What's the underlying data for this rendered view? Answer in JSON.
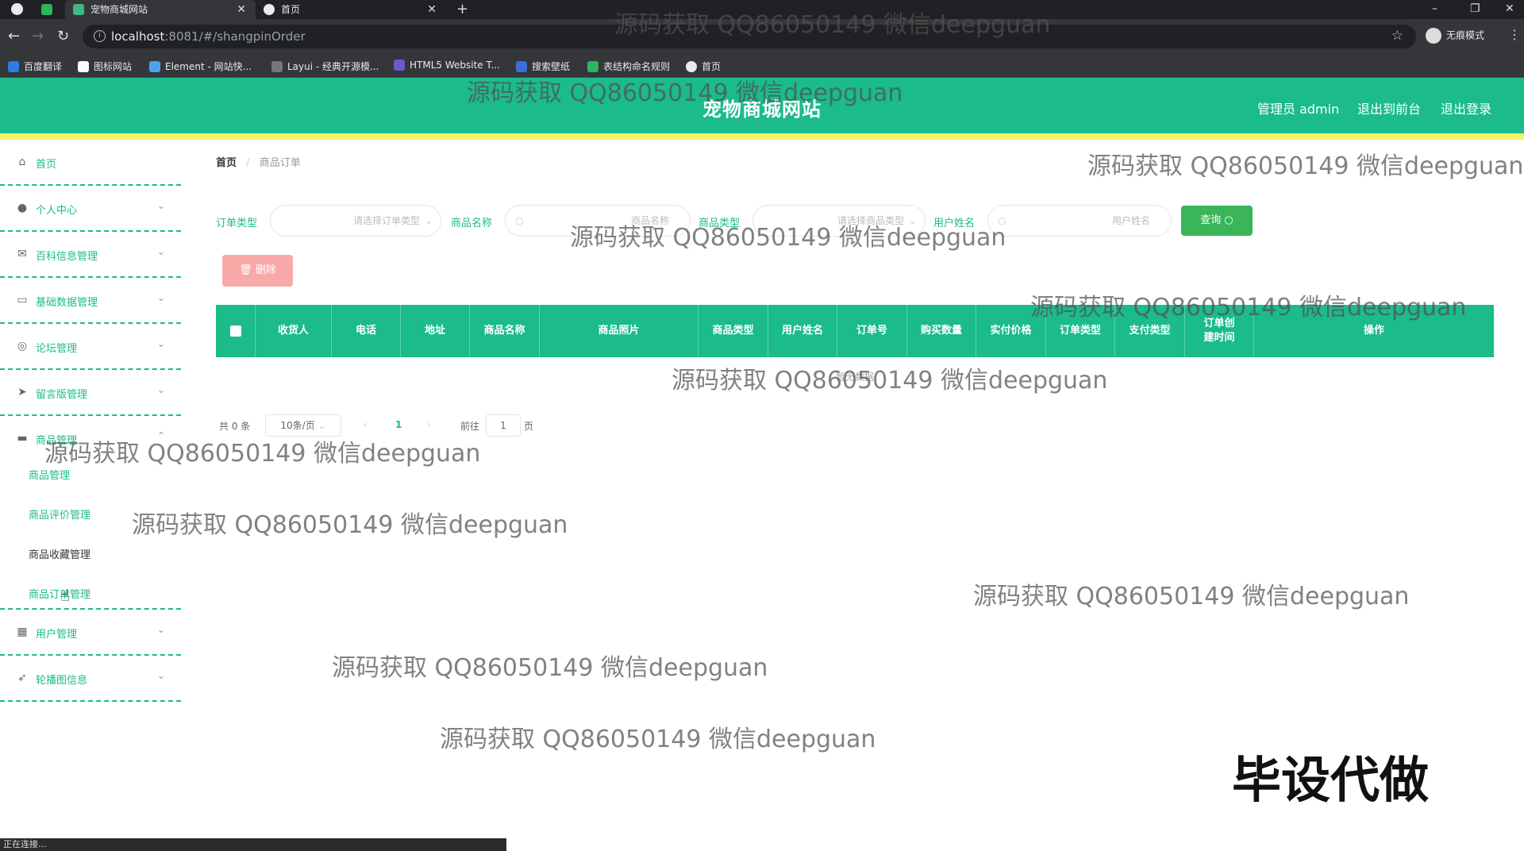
{
  "browser": {
    "tabs": [
      {
        "title": "宠物商城网站",
        "active": true
      },
      {
        "title": "首页",
        "active": false
      }
    ],
    "url_host": "localhost",
    "url_rest": ":8081/#/shangpinOrder",
    "incognito_label": "无痕模式",
    "bookmarks": [
      "百度翻译",
      "图标网站",
      "Element - 网站快...",
      "Layui - 经典开源模...",
      "HTML5 Website T...",
      "搜索壁纸",
      "表结构命名规则",
      "首页"
    ],
    "status": "正在连接..."
  },
  "header": {
    "site_title": "宠物商城网站",
    "admin": "管理员 admin",
    "to_front": "退出到前台",
    "logout": "退出登录",
    "accent": "#1bbb8a"
  },
  "sidebar": {
    "items": [
      {
        "label": "首页"
      },
      {
        "label": "个人中心"
      },
      {
        "label": "百科信息管理"
      },
      {
        "label": "基础数据管理"
      },
      {
        "label": "论坛管理"
      },
      {
        "label": "留言版管理"
      },
      {
        "label": "商品管理"
      },
      {
        "label": "用户管理"
      },
      {
        "label": "轮播图信息"
      }
    ],
    "sub_items": [
      "商品管理",
      "商品评价管理",
      "商品收藏管理",
      "商品订单管理"
    ]
  },
  "breadcrumb": {
    "home": "首页",
    "sep": "/",
    "current": "商品订单"
  },
  "filters": {
    "order_type_label": "订单类型",
    "order_type_placeholder": "请选择订单类型",
    "product_name_label": "商品名称",
    "product_name_placeholder": "商品名称",
    "product_type_label": "商品类型",
    "product_type_placeholder": "请选择商品类型",
    "user_name_label": "用户姓名",
    "user_name_placeholder": "用户姓名",
    "search_button": "查询"
  },
  "actions": {
    "delete_button": "删除"
  },
  "table": {
    "columns": [
      "收货人",
      "电话",
      "地址",
      "商品名称",
      "商品照片",
      "商品类型",
      "用户姓名",
      "订单号",
      "购买数量",
      "实付价格",
      "订单类型",
      "支付类型",
      "订单创建时间",
      "操作"
    ],
    "empty_text": "暂无数据"
  },
  "pagination": {
    "total": "共 0 条",
    "page_size": "10条/页",
    "current_page": "1",
    "goto_label": "前往",
    "goto_value": "1",
    "page_suffix": "页"
  },
  "watermark": "源码获取 QQ86050149 微信deepguan",
  "stamp": "毕设代做"
}
